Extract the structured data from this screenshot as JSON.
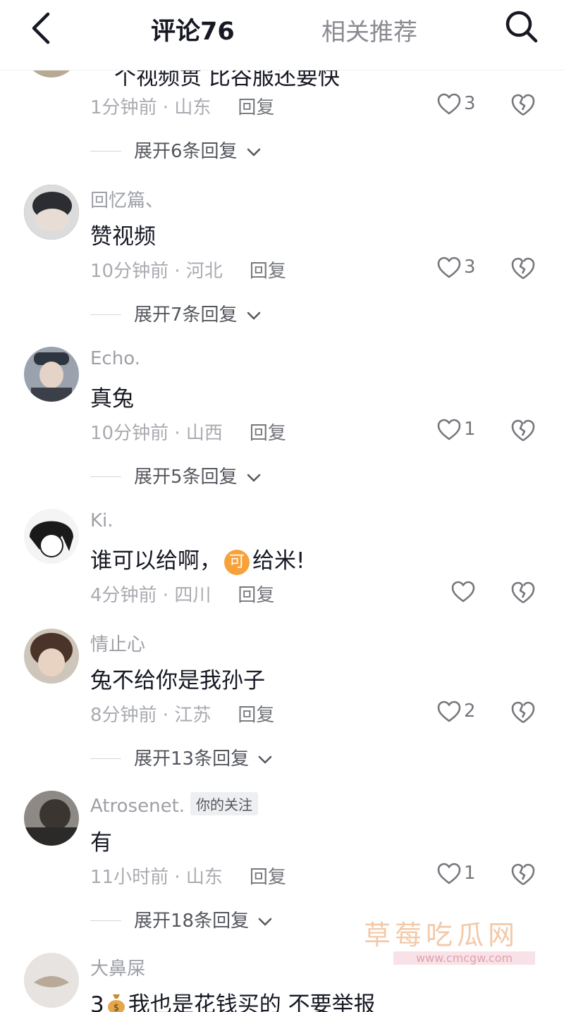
{
  "header": {
    "active_tab": "评论76",
    "other_tab": "相关推荐"
  },
  "first_item": {
    "truncated_text": "个视频贯 比谷服还要快",
    "time_location": "1分钟前 · 山东",
    "reply_label": "回复",
    "likes": "3",
    "expand_label": "展开6条回复"
  },
  "comments": [
    {
      "username": "回忆篇、",
      "text": "赞视频",
      "time_location": "10分钟前 · 河北",
      "reply_label": "回复",
      "likes": "3",
      "expand_label": "展开7条回复"
    },
    {
      "username": "Echo.",
      "text": "真兔",
      "time_location": "10分钟前 · 山西",
      "reply_label": "回复",
      "likes": "1",
      "expand_label": "展开5条回复"
    },
    {
      "username": "Ki.",
      "text_before": "谁可以给啊，",
      "coin_glyph": "可",
      "text_after": "给米!",
      "time_location": "4分钟前 · 四川",
      "reply_label": "回复",
      "likes": ""
    },
    {
      "username": "情止心",
      "text": "兔不给你是我孙子",
      "time_location": "8分钟前 · 江苏",
      "reply_label": "回复",
      "likes": "2",
      "expand_label": "展开13条回复"
    },
    {
      "username": "Atrosenet.",
      "badge": "你的关注",
      "text": "有",
      "time_location": "11小时前 · 山东",
      "reply_label": "回复",
      "likes": "1",
      "expand_label": "展开18条回复"
    },
    {
      "username": "大鼻屎",
      "text_prefix": "3",
      "text": "我也是花钱买的 不要举报"
    }
  ],
  "watermark": {
    "title": "草莓吃瓜网",
    "url": "www.cmcgw.com"
  },
  "colors": {
    "primary_text": "#161823",
    "secondary_text": "#a9abb0",
    "coin": "#f7a13b"
  }
}
